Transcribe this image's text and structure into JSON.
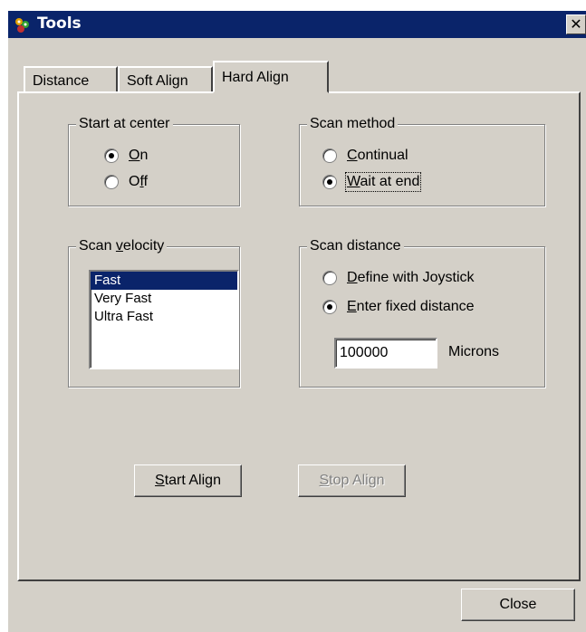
{
  "window": {
    "title": "Tools",
    "close_glyph": "✕"
  },
  "tabs": [
    {
      "label": "Distance",
      "active": false
    },
    {
      "label": "Soft Align",
      "active": false
    },
    {
      "label": "Hard Align",
      "active": true
    }
  ],
  "start_at_center": {
    "legend": "Start at center",
    "options": [
      {
        "pre": "",
        "mnemonic": "O",
        "post": "n",
        "selected": true
      },
      {
        "pre": "O",
        "mnemonic": "f",
        "post": "f",
        "selected": false
      }
    ]
  },
  "scan_method": {
    "legend": "Scan method",
    "options": [
      {
        "pre": "",
        "mnemonic": "C",
        "post": "ontinual",
        "selected": false
      },
      {
        "pre": "",
        "mnemonic": "W",
        "post": "ait at end",
        "selected": true
      }
    ]
  },
  "scan_velocity": {
    "legend_pre": "Scan ",
    "legend_mnemonic": "v",
    "legend_post": "elocity",
    "items": [
      "Fast",
      "Very Fast",
      "Ultra Fast"
    ],
    "selected": "Fast"
  },
  "scan_distance": {
    "legend": "Scan distance",
    "options": [
      {
        "pre": "",
        "mnemonic": "D",
        "post": "efine with Joystick",
        "selected": false
      },
      {
        "pre": "",
        "mnemonic": "E",
        "post": "nter fixed distance",
        "selected": true
      }
    ],
    "value": "100000",
    "unit": "Microns"
  },
  "actions": {
    "start": {
      "mnemonic": "S",
      "rest": "tart Align",
      "enabled": true
    },
    "stop": {
      "mnemonic": "S",
      "rest": "top Align",
      "enabled": false
    },
    "close": "Close"
  },
  "icons": {
    "app": "tools-app-icon"
  },
  "colors": {
    "titlebar": "#0a246a",
    "face": "#d4d0c8",
    "selection": "#0a246a"
  }
}
